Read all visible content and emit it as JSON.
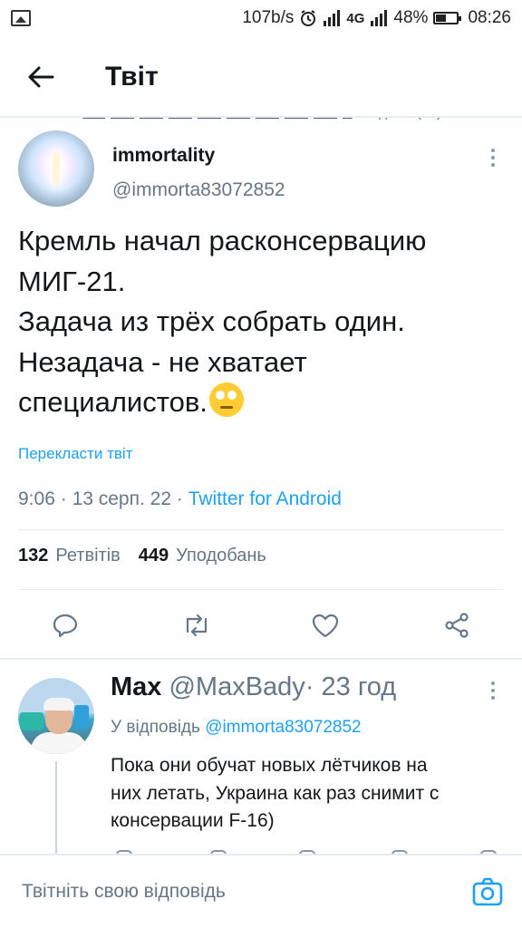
{
  "status_bar": {
    "speed": "107b/s",
    "network": "4G",
    "battery": "48%",
    "time": "08:26",
    "icons": [
      "gallery-icon",
      "alarm-icon",
      "signal-icon",
      "battery-icon"
    ]
  },
  "header": {
    "title": "Твіт"
  },
  "above_peek": "вподобав(ла)",
  "tweet": {
    "author_name": "immortality",
    "author_handle": "@immorta83072852",
    "text_lines": [
      "Кремль начал расконсервацию",
      "МИГ-21.",
      "Задача из трёх собрать один.",
      "Незадача - не хватает",
      "специалистов."
    ],
    "translate_label": "Перекласти твіт",
    "time": "9:06",
    "date": "13 серп. 22",
    "separator": "·",
    "source": "Twitter for Android",
    "retweets_count": "132",
    "retweets_label": "Ретвітів",
    "likes_count": "449",
    "likes_label": "Уподобань"
  },
  "reply": {
    "name": "Max",
    "handle": "@MaxBady",
    "separator": "·",
    "time": "23 год",
    "reply_to_label": "У відповідь",
    "reply_to_handle": "@immorta83072852",
    "text_lines": [
      "Пока они обучат новых лётчиков на",
      "них летать, Украина как раз снимит с",
      "консервации F-16)"
    ]
  },
  "compose": {
    "placeholder": "Твітніть свою відповідь"
  },
  "colors": {
    "accent": "#1da1f2",
    "text_primary": "#14171a",
    "text_secondary": "#657786",
    "divider": "#e6ecf0"
  }
}
